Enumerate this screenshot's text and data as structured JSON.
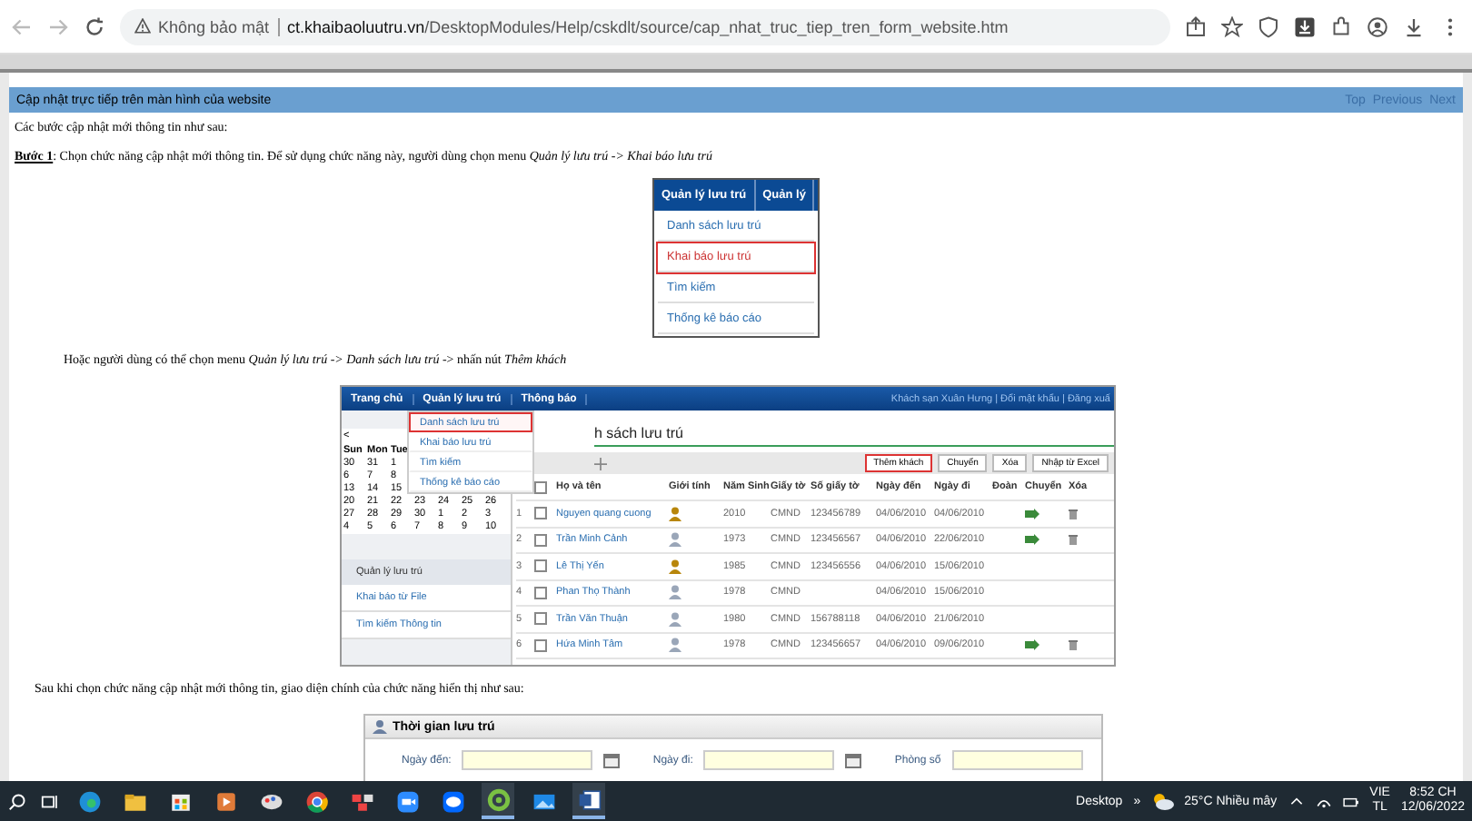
{
  "browser": {
    "security": "Không bảo mật",
    "url_domain": "ct.khaibaoluutru.vn",
    "url_path": "/DesktopModules/Help/cskdlt/source/cap_nhat_truc_tiep_tren_form_website.htm"
  },
  "topic": {
    "title": "Cập nhật trực tiếp trên màn hình của website",
    "links": [
      "Top",
      "Previous",
      "Next"
    ]
  },
  "intro": "Các bước cập nhật mới thông tin như sau:",
  "step1": {
    "label": "Bước 1",
    "text": ": Chọn chức năng cập nhật mới thông tin. Để sử dụng chức năng này, người dùng chọn menu *Quản lý lưu trú -> Khai báo lưu trú*"
  },
  "menu_image": {
    "headers": [
      "Quản lý lưu trú",
      "Quản lý"
    ],
    "items": [
      {
        "label": "Danh sách lưu trú",
        "selected": false
      },
      {
        "label": "Khai báo lưu trú",
        "selected": true
      },
      {
        "label": "Tìm kiếm",
        "selected": false
      },
      {
        "label": "Thống kê báo cáo",
        "selected": false
      }
    ]
  },
  "alt_text": "Hoặc người dùng có thể chọn menu *Quản lý lưu trú -> Danh sách lưu trú* -> nhấn nút *Thêm khách*",
  "app_image": {
    "nav": [
      "Trang chủ",
      "Quản lý lưu trú",
      "Thông báo"
    ],
    "user_links": "Khách sạn Xuân Hưng | Đổi mật khẩu | Đăng xuấ",
    "dropdown": [
      {
        "label": "Danh sách lưu trú",
        "selected": true
      },
      {
        "label": "Khai báo lưu trú",
        "selected": false
      },
      {
        "label": "Tìm kiếm",
        "selected": false
      },
      {
        "label": "Thống kê báo cáo",
        "selected": false
      }
    ],
    "calendar": {
      "prev": "<",
      "days": [
        "Sun",
        "Mon",
        "Tue"
      ],
      "weeks": [
        [
          "30",
          "31",
          "1"
        ],
        [
          "6",
          "7",
          "8"
        ],
        [
          "13",
          "14",
          "15"
        ],
        [
          "20",
          "21",
          "22",
          "23",
          "24",
          "25",
          "26"
        ],
        [
          "27",
          "28",
          "29",
          "30",
          "1",
          "2",
          "3"
        ],
        [
          "4",
          "5",
          "6",
          "7",
          "8",
          "9",
          "10"
        ]
      ]
    },
    "side_title": "Quản lý lưu trú",
    "side_items": [
      "Khai báo từ File",
      "Tìm kiếm Thông tin"
    ],
    "page_title": "h sách lưu trú",
    "toolbar": [
      {
        "label": "Thêm khách",
        "selected": true
      },
      {
        "label": "Chuyển",
        "selected": false
      },
      {
        "label": "Xóa",
        "selected": false
      },
      {
        "label": "Nhập từ Excel",
        "selected": false
      }
    ],
    "select_all": {
      "checked": false
    },
    "columns": [
      "Họ và tên",
      "Giới tính",
      "Năm Sinh",
      "Giấy tờ",
      "Số giấy tờ",
      "Ngày đến",
      "Ngày đi",
      "Đoàn",
      "Chuyển",
      "Xóa"
    ],
    "rows": [
      {
        "no": "1",
        "checked": false,
        "name": "Nguyen quang cuong",
        "kind": "female",
        "year": "2010",
        "doc": "CMND",
        "doc_no": "123456789",
        "arrive": "04/06/2010",
        "depart": "04/06/2010",
        "actions": true
      },
      {
        "no": "2",
        "checked": false,
        "name": "Trần Minh Cảnh",
        "kind": "male",
        "year": "1973",
        "doc": "CMND",
        "doc_no": "123456567",
        "arrive": "04/06/2010",
        "depart": "22/06/2010",
        "actions": true
      },
      {
        "no": "3",
        "checked": false,
        "name": "Lê Thị Yến",
        "kind": "female",
        "year": "1985",
        "doc": "CMND",
        "doc_no": "123456556",
        "arrive": "04/06/2010",
        "depart": "15/06/2010",
        "actions": false
      },
      {
        "no": "4",
        "checked": false,
        "name": "Phan Thọ Thành",
        "kind": "male",
        "year": "1978",
        "doc": "CMND",
        "arrive": "04/06/2010",
        "depart": "15/06/2010",
        "actions": false
      },
      {
        "no": "5",
        "checked": false,
        "name": "Trần Văn Thuận",
        "kind": "male",
        "year": "1980",
        "doc": "CMND",
        "doc_no": "156788118",
        "arrive": "04/06/2010",
        "depart": "21/06/2010",
        "actions": false
      },
      {
        "no": "6",
        "checked": false,
        "name": "Hứa Minh Tâm",
        "kind": "male",
        "year": "1978",
        "doc": "CMND",
        "doc_no": "123456657",
        "arrive": "04/06/2010",
        "depart": "09/06/2010",
        "actions": true
      }
    ]
  },
  "after_text": "Sau khi  chọn chức năng cập nhật mới thông tin, giao diện chính của chức năng hiển thị như sau:",
  "form_image": {
    "title": "Thời gian lưu trú",
    "fields": [
      {
        "label": "Ngày đến:",
        "kind": "date"
      },
      {
        "label": "Ngày đi:",
        "kind": "date"
      },
      {
        "label": "Phòng số",
        "kind": "text"
      }
    ]
  },
  "taskbar": {
    "apps": [
      {
        "kind": "edge",
        "active": false
      },
      {
        "kind": "folder",
        "active": false
      },
      {
        "kind": "store",
        "active": false
      },
      {
        "kind": "media",
        "active": false
      },
      {
        "kind": "paint",
        "active": false
      },
      {
        "kind": "chrome",
        "active": false
      },
      {
        "kind": "tiles",
        "active": false
      },
      {
        "kind": "camera",
        "active": false
      },
      {
        "kind": "chat",
        "active": false
      },
      {
        "kind": "ring",
        "active": true
      },
      {
        "kind": "photos",
        "active": false
      },
      {
        "kind": "word",
        "active": true
      }
    ],
    "desktop": "Desktop",
    "more": "»",
    "weather": "25°C Nhiều mây",
    "lang": [
      "VIE",
      "TL"
    ],
    "time": "8:52 CH",
    "date": "12/06/2022"
  }
}
